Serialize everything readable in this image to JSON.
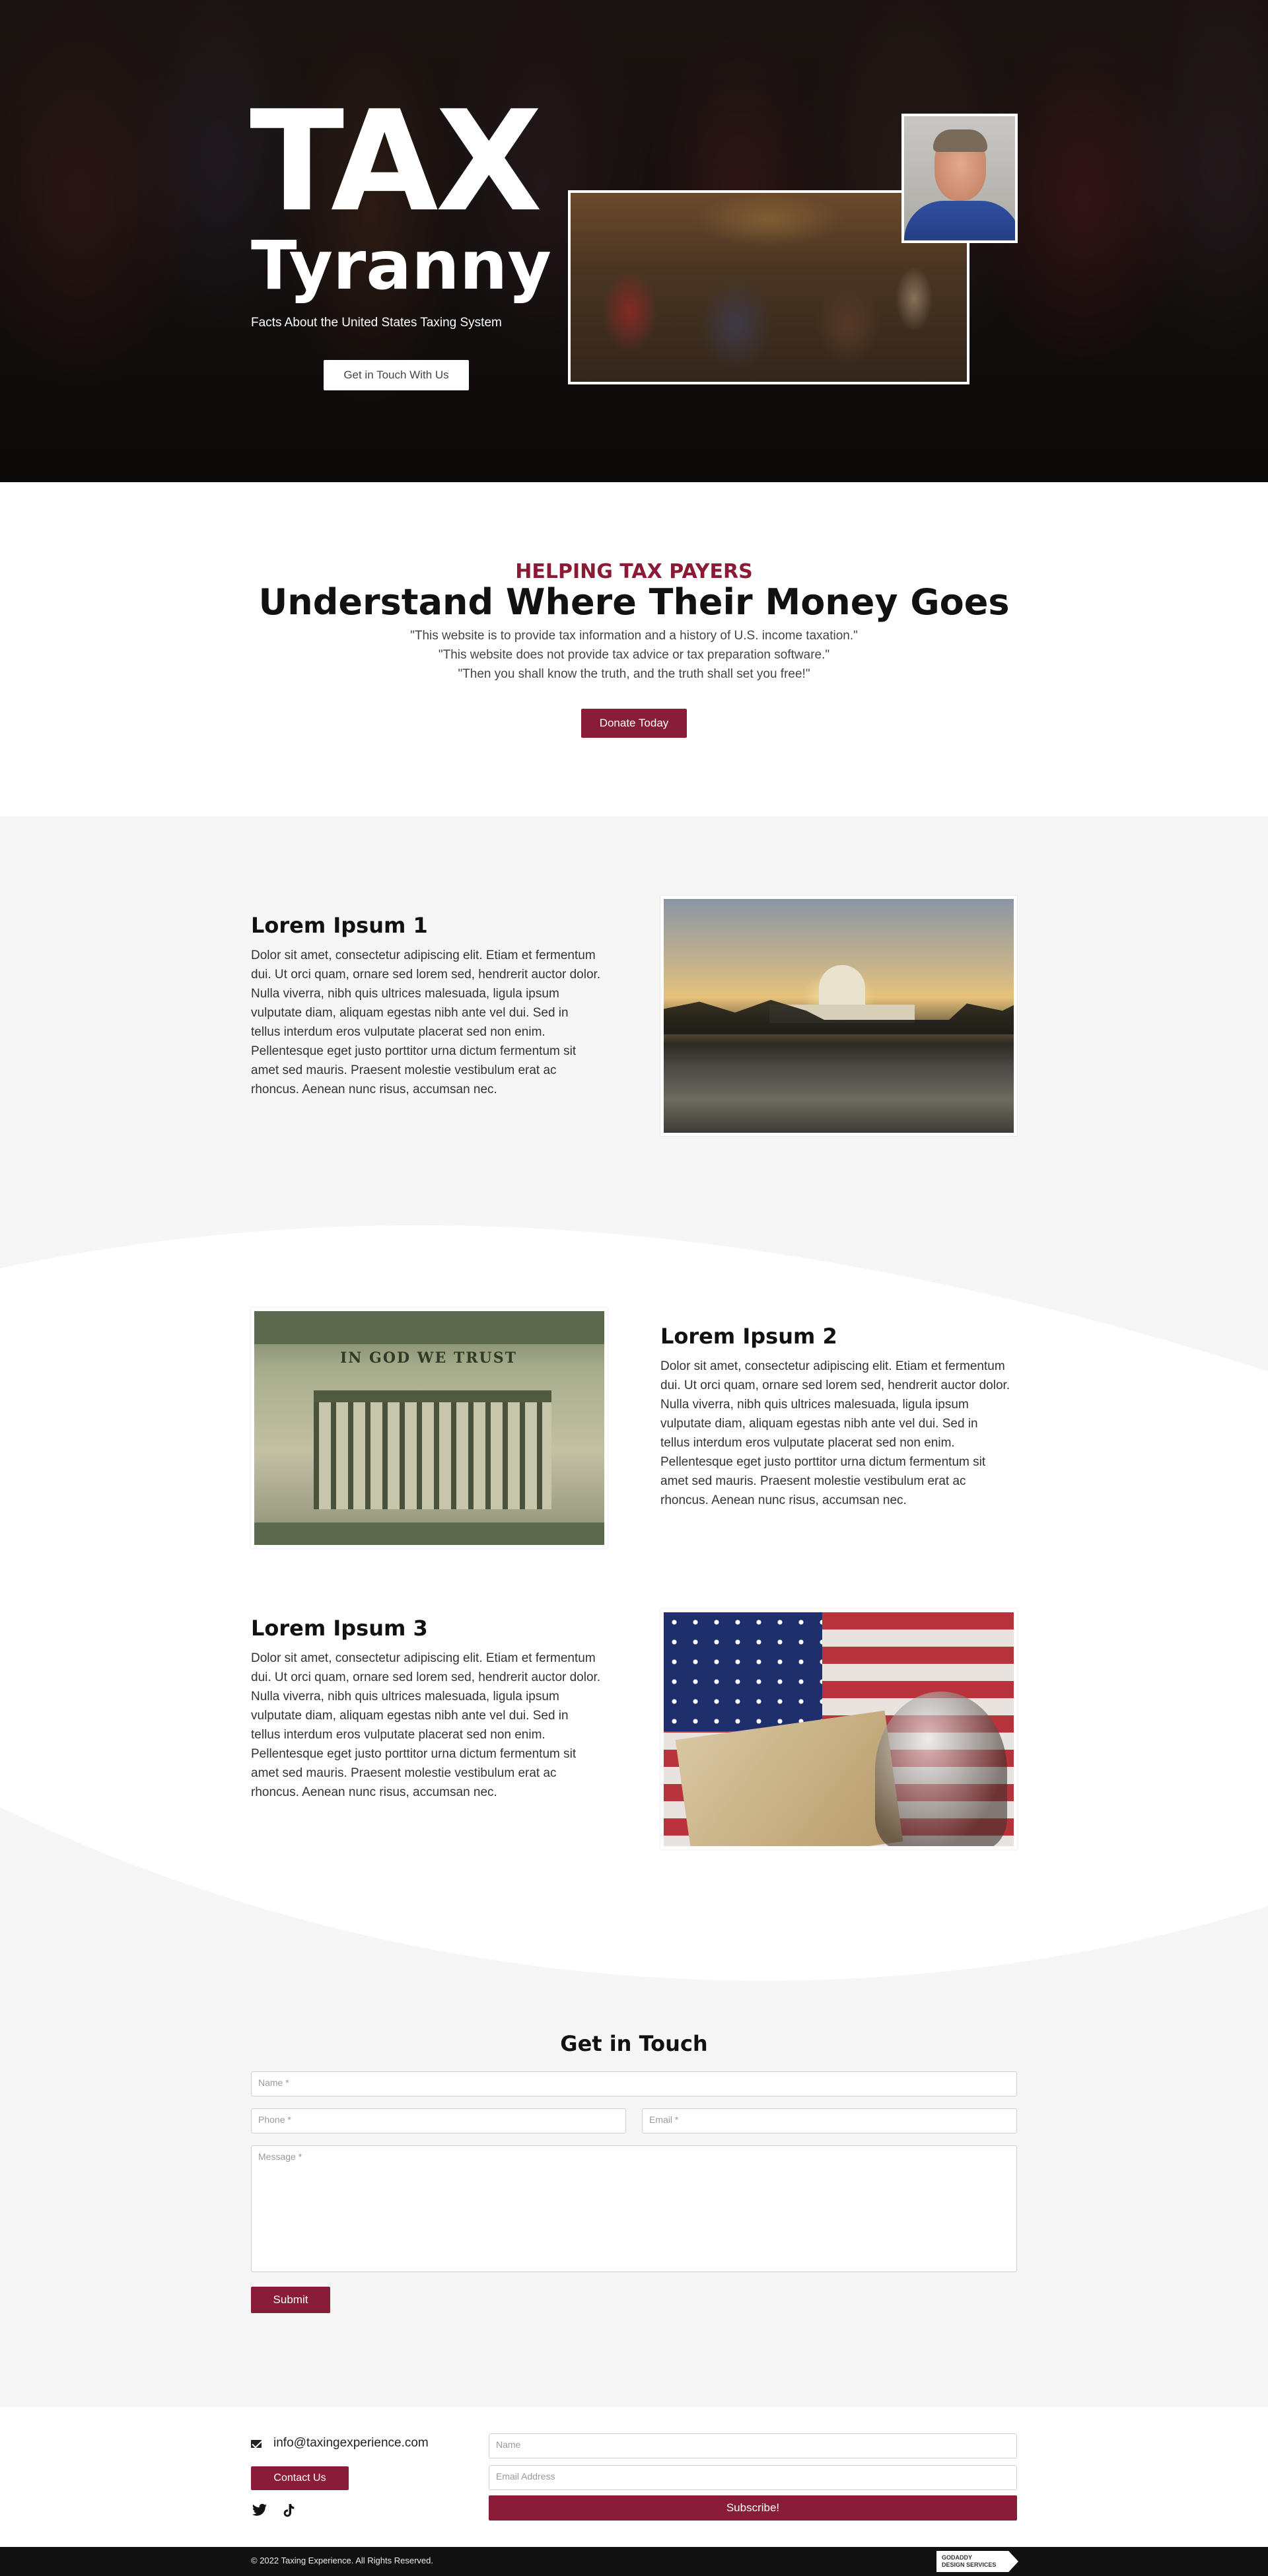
{
  "hero": {
    "title_big": "TAX",
    "title_sub": "Tyranny",
    "tagline": "Facts About the United States Taxing System",
    "cta_label": "Get in Touch With Us"
  },
  "intro": {
    "kicker": "HELPING TAX PAYERS",
    "title": "Understand Where Their Money Goes",
    "quotes": [
      "\"This website is to provide tax information and a history of U.S. income taxation.\"",
      "\"This website does not provide tax advice or tax preparation software.\"",
      "\"Then you shall know the truth, and the truth shall set you free!\""
    ],
    "donate_label": "Donate Today"
  },
  "features": [
    {
      "title": "Lorem Ipsum 1",
      "body": "Dolor sit amet, consectetur adipiscing elit. Etiam et fermentum dui. Ut orci quam, ornare sed lorem sed, hendrerit auctor dolor. Nulla viverra, nibh quis ultrices malesuada, ligula ipsum vulputate diam, aliquam egestas nibh ante vel dui. Sed in tellus interdum eros vulputate placerat sed non enim. Pellentesque eget justo porttitor urna dictum fermentum sit amet sed mauris. Praesent molestie vestibulum erat ac rhoncus. Aenean nunc risus, accumsan nec."
    },
    {
      "title": "Lorem Ipsum 2",
      "body": "Dolor sit amet, consectetur adipiscing elit. Etiam et fermentum dui. Ut orci quam, ornare sed lorem sed, hendrerit auctor dolor. Nulla viverra, nibh quis ultrices malesuada, ligula ipsum vulputate diam, aliquam egestas nibh ante vel dui. Sed in tellus interdum eros vulputate placerat sed non enim. Pellentesque eget justo porttitor urna dictum fermentum sit amet sed mauris. Praesent molestie vestibulum erat ac rhoncus. Aenean nunc risus, accumsan nec."
    },
    {
      "title": "Lorem Ipsum 3",
      "body": "Dolor sit amet, consectetur adipiscing elit. Etiam et fermentum dui. Ut orci quam, ornare sed lorem sed, hendrerit auctor dolor. Nulla viverra, nibh quis ultrices malesuada, ligula ipsum vulputate diam, aliquam egestas nibh ante vel dui. Sed in tellus interdum eros vulputate placerat sed non enim. Pellentesque eget justo porttitor urna dictum fermentum sit amet sed mauris. Praesent molestie vestibulum erat ac rhoncus. Aenean nunc risus, accumsan nec."
    }
  ],
  "treasury_image": {
    "motto": "IN GOD WE TRUST"
  },
  "contact": {
    "title": "Get in Touch",
    "name_placeholder": "Name *",
    "phone_placeholder": "Phone *",
    "email_placeholder": "Email *",
    "message_placeholder": "Message *",
    "submit_label": "Submit"
  },
  "footer": {
    "email": "info@taxingexperience.com",
    "contact_label": "Contact Us",
    "newsletter_name_placeholder": "Name",
    "newsletter_email_placeholder": "Email Address",
    "subscribe_label": "Subscribe!",
    "copyright": "© 2022 Taxing Experience. All Rights Reserved.",
    "badge_line1": "GODADDY",
    "badge_line2": "DESIGN SERVICES"
  },
  "colors": {
    "accent": "#891c36",
    "kicker": "#8a1a36",
    "section_bg": "#f6f6f6",
    "footer_bar": "#111111"
  },
  "icons": {
    "email": "mail-icon",
    "twitter": "twitter-icon",
    "tiktok": "tiktok-icon"
  }
}
